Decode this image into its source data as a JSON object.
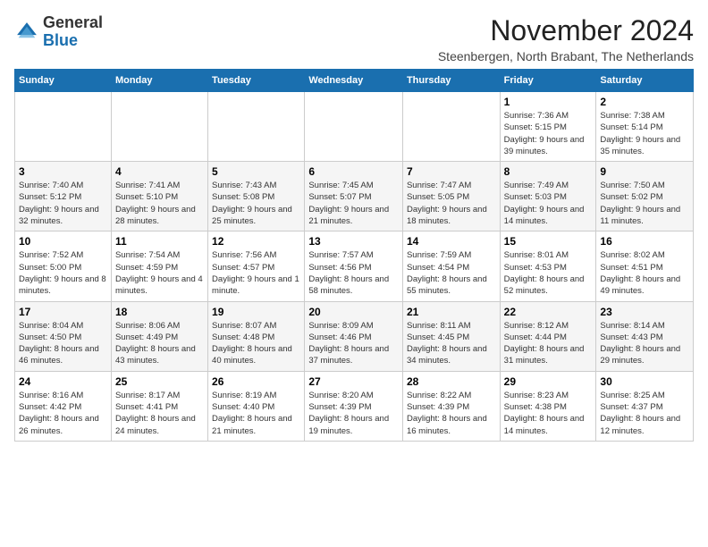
{
  "logo": {
    "general": "General",
    "blue": "Blue"
  },
  "header": {
    "month_title": "November 2024",
    "subtitle": "Steenbergen, North Brabant, The Netherlands"
  },
  "days_of_week": [
    "Sunday",
    "Monday",
    "Tuesday",
    "Wednesday",
    "Thursday",
    "Friday",
    "Saturday"
  ],
  "weeks": [
    [
      {
        "day": "",
        "info": ""
      },
      {
        "day": "",
        "info": ""
      },
      {
        "day": "",
        "info": ""
      },
      {
        "day": "",
        "info": ""
      },
      {
        "day": "",
        "info": ""
      },
      {
        "day": "1",
        "info": "Sunrise: 7:36 AM\nSunset: 5:15 PM\nDaylight: 9 hours\nand 39 minutes."
      },
      {
        "day": "2",
        "info": "Sunrise: 7:38 AM\nSunset: 5:14 PM\nDaylight: 9 hours\nand 35 minutes."
      }
    ],
    [
      {
        "day": "3",
        "info": "Sunrise: 7:40 AM\nSunset: 5:12 PM\nDaylight: 9 hours\nand 32 minutes."
      },
      {
        "day": "4",
        "info": "Sunrise: 7:41 AM\nSunset: 5:10 PM\nDaylight: 9 hours\nand 28 minutes."
      },
      {
        "day": "5",
        "info": "Sunrise: 7:43 AM\nSunset: 5:08 PM\nDaylight: 9 hours\nand 25 minutes."
      },
      {
        "day": "6",
        "info": "Sunrise: 7:45 AM\nSunset: 5:07 PM\nDaylight: 9 hours\nand 21 minutes."
      },
      {
        "day": "7",
        "info": "Sunrise: 7:47 AM\nSunset: 5:05 PM\nDaylight: 9 hours\nand 18 minutes."
      },
      {
        "day": "8",
        "info": "Sunrise: 7:49 AM\nSunset: 5:03 PM\nDaylight: 9 hours\nand 14 minutes."
      },
      {
        "day": "9",
        "info": "Sunrise: 7:50 AM\nSunset: 5:02 PM\nDaylight: 9 hours\nand 11 minutes."
      }
    ],
    [
      {
        "day": "10",
        "info": "Sunrise: 7:52 AM\nSunset: 5:00 PM\nDaylight: 9 hours\nand 8 minutes."
      },
      {
        "day": "11",
        "info": "Sunrise: 7:54 AM\nSunset: 4:59 PM\nDaylight: 9 hours\nand 4 minutes."
      },
      {
        "day": "12",
        "info": "Sunrise: 7:56 AM\nSunset: 4:57 PM\nDaylight: 9 hours\nand 1 minute."
      },
      {
        "day": "13",
        "info": "Sunrise: 7:57 AM\nSunset: 4:56 PM\nDaylight: 8 hours\nand 58 minutes."
      },
      {
        "day": "14",
        "info": "Sunrise: 7:59 AM\nSunset: 4:54 PM\nDaylight: 8 hours\nand 55 minutes."
      },
      {
        "day": "15",
        "info": "Sunrise: 8:01 AM\nSunset: 4:53 PM\nDaylight: 8 hours\nand 52 minutes."
      },
      {
        "day": "16",
        "info": "Sunrise: 8:02 AM\nSunset: 4:51 PM\nDaylight: 8 hours\nand 49 minutes."
      }
    ],
    [
      {
        "day": "17",
        "info": "Sunrise: 8:04 AM\nSunset: 4:50 PM\nDaylight: 8 hours\nand 46 minutes."
      },
      {
        "day": "18",
        "info": "Sunrise: 8:06 AM\nSunset: 4:49 PM\nDaylight: 8 hours\nand 43 minutes."
      },
      {
        "day": "19",
        "info": "Sunrise: 8:07 AM\nSunset: 4:48 PM\nDaylight: 8 hours\nand 40 minutes."
      },
      {
        "day": "20",
        "info": "Sunrise: 8:09 AM\nSunset: 4:46 PM\nDaylight: 8 hours\nand 37 minutes."
      },
      {
        "day": "21",
        "info": "Sunrise: 8:11 AM\nSunset: 4:45 PM\nDaylight: 8 hours\nand 34 minutes."
      },
      {
        "day": "22",
        "info": "Sunrise: 8:12 AM\nSunset: 4:44 PM\nDaylight: 8 hours\nand 31 minutes."
      },
      {
        "day": "23",
        "info": "Sunrise: 8:14 AM\nSunset: 4:43 PM\nDaylight: 8 hours\nand 29 minutes."
      }
    ],
    [
      {
        "day": "24",
        "info": "Sunrise: 8:16 AM\nSunset: 4:42 PM\nDaylight: 8 hours\nand 26 minutes."
      },
      {
        "day": "25",
        "info": "Sunrise: 8:17 AM\nSunset: 4:41 PM\nDaylight: 8 hours\nand 24 minutes."
      },
      {
        "day": "26",
        "info": "Sunrise: 8:19 AM\nSunset: 4:40 PM\nDaylight: 8 hours\nand 21 minutes."
      },
      {
        "day": "27",
        "info": "Sunrise: 8:20 AM\nSunset: 4:39 PM\nDaylight: 8 hours\nand 19 minutes."
      },
      {
        "day": "28",
        "info": "Sunrise: 8:22 AM\nSunset: 4:39 PM\nDaylight: 8 hours\nand 16 minutes."
      },
      {
        "day": "29",
        "info": "Sunrise: 8:23 AM\nSunset: 4:38 PM\nDaylight: 8 hours\nand 14 minutes."
      },
      {
        "day": "30",
        "info": "Sunrise: 8:25 AM\nSunset: 4:37 PM\nDaylight: 8 hours\nand 12 minutes."
      }
    ]
  ]
}
